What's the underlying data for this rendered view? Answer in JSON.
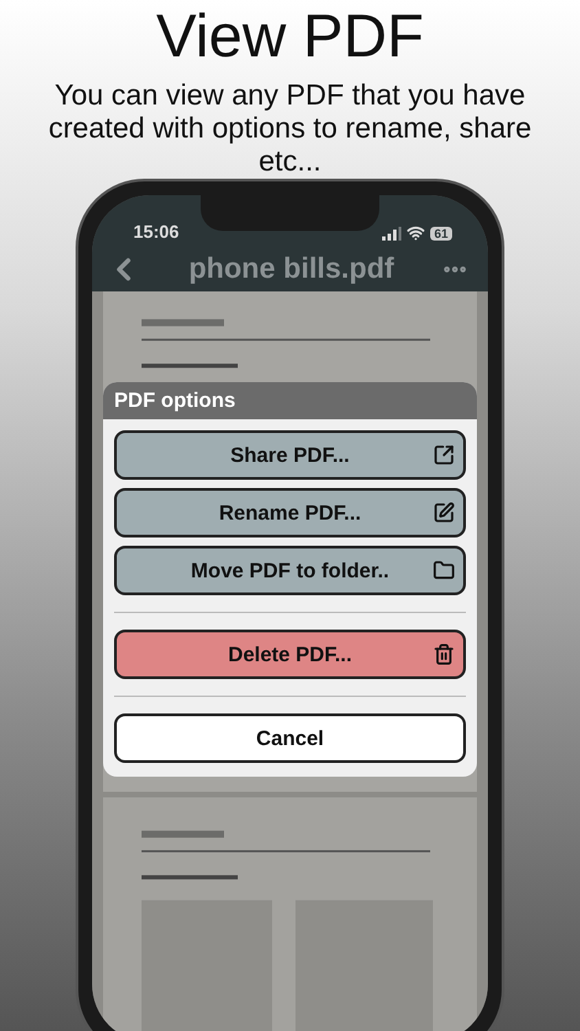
{
  "heading": "View PDF",
  "subtitle": "You can view any PDF that you have created with options to rename, share etc...",
  "status_bar": {
    "time": "15:06",
    "battery": "61"
  },
  "nav": {
    "title": "phone bills.pdf"
  },
  "dialog": {
    "title": "PDF options",
    "actions": [
      {
        "label": "Share PDF...",
        "kind": "share"
      },
      {
        "label": "Rename PDF...",
        "kind": "rename"
      },
      {
        "label": "Move PDF to folder..",
        "kind": "move"
      },
      {
        "label": "Delete PDF...",
        "kind": "delete"
      }
    ],
    "cancel": "Cancel"
  }
}
